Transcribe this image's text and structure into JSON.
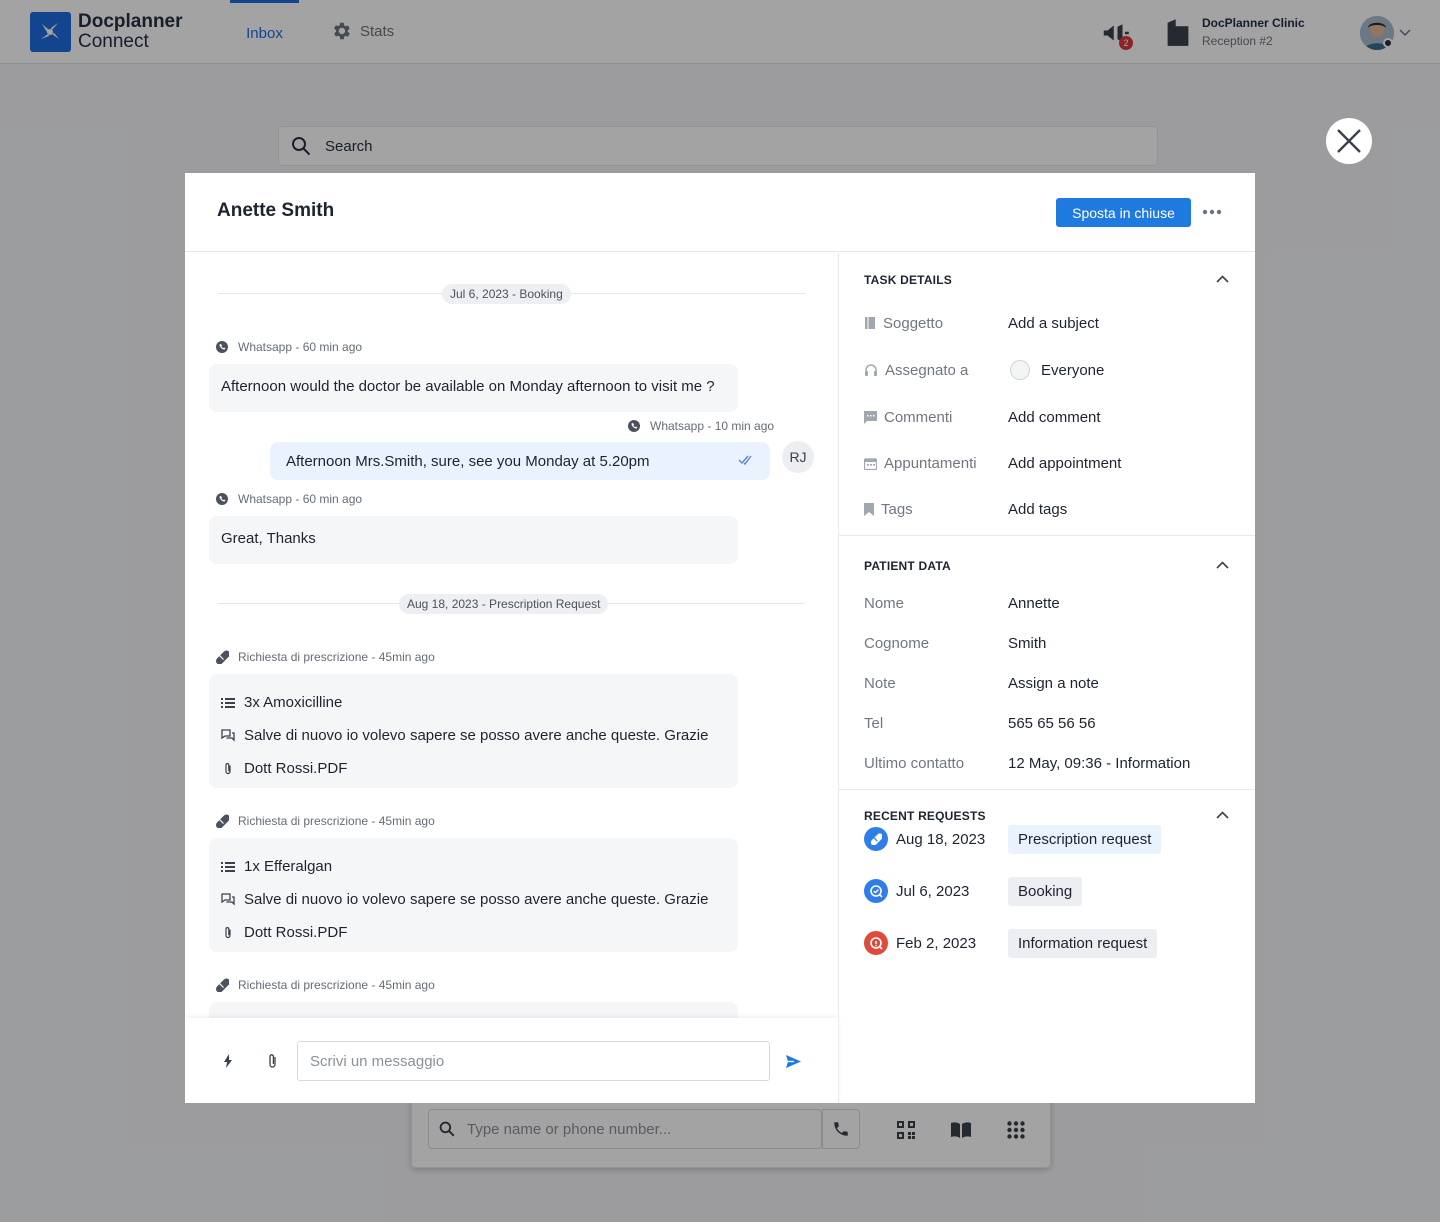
{
  "app": {
    "logo_line1": "Docplanner",
    "logo_line2": "Connect",
    "nav": {
      "inbox": "Inbox",
      "stats": "Stats"
    },
    "notification_count": "2",
    "clinic_name": "DocPlanner Clinic",
    "clinic_sub": "Reception #2",
    "search_placeholder": "Search",
    "dialer_placeholder": "Type name or phone number..."
  },
  "modal": {
    "title": "Anette Smith",
    "primary_button": "Sposta in chiuse",
    "conversation": {
      "date_sep_1": "Jul 6, 2023 - Booking",
      "date_sep_2": "Aug 18, 2023 - Prescription Request",
      "msg1": {
        "meta": "Whatsapp - 60 min ago",
        "text": "Afternoon would the doctor be available on Monday afternoon to visit me ?"
      },
      "msg2": {
        "meta": "Whatsapp - 10 min ago",
        "text": "Afternoon Mrs.Smith, sure,  see you Monday at 5.20pm",
        "avatar": "RJ"
      },
      "msg3": {
        "meta": "Whatsapp - 60 min ago",
        "text": "Great, Thanks"
      },
      "presc1": {
        "meta": "Richiesta di prescrizione - 45min ago",
        "drug": "3x Amoxicilline",
        "note": "Salve di nuovo io volevo sapere se posso avere anche queste. Grazie",
        "file": "Dott Rossi.PDF"
      },
      "presc2": {
        "meta": "Richiesta di prescrizione - 45min ago",
        "drug": "1x Efferalgan",
        "note": "Salve di nuovo io volevo sapere se posso avere anche queste. Grazie",
        "file": "Dott Rossi.PDF"
      },
      "presc3": {
        "meta": "Richiesta di prescrizione - 45min ago"
      }
    },
    "composer": {
      "placeholder": "Scrivi un messaggio"
    },
    "task_details": {
      "title": "TASK DETAILS",
      "rows": [
        {
          "label": "Soggetto",
          "value": "Add a subject"
        },
        {
          "label": "Assegnato a",
          "value": "Everyone"
        },
        {
          "label": "Commenti",
          "value": "Add comment"
        },
        {
          "label": "Appuntamenti",
          "value": "Add appointment"
        },
        {
          "label": "Tags",
          "value": "Add tags"
        }
      ]
    },
    "patient_data": {
      "title": "PATIENT DATA",
      "rows": [
        {
          "label": "Nome",
          "value": "Annette"
        },
        {
          "label": "Cognome",
          "value": "Smith"
        },
        {
          "label": "Note",
          "value": "Assign a note"
        },
        {
          "label": "Tel",
          "value": "565 65 56 56"
        },
        {
          "label": "Ultimo contatto",
          "value": "12 May, 09:36 - Information"
        }
      ]
    },
    "recent_requests": {
      "title": "RECENT REQUESTS",
      "items": [
        {
          "date": "Aug 18, 2023",
          "tag": "Prescription request",
          "icon": "pill-icon",
          "color": "#2f7ee8",
          "tag_bg": "#e9f2fd"
        },
        {
          "date": "Jul 6, 2023",
          "tag": "Booking",
          "icon": "calendar-check-icon",
          "color": "#2f7ee8",
          "tag_bg": "#eceef1"
        },
        {
          "date": "Feb 2, 2023",
          "tag": "Information request",
          "icon": "info-chat-icon",
          "color": "#e04a3b",
          "tag_bg": "#eceef1"
        }
      ]
    }
  },
  "colors": {
    "primary": "#1f7ae0",
    "danger": "#d93a3a"
  }
}
